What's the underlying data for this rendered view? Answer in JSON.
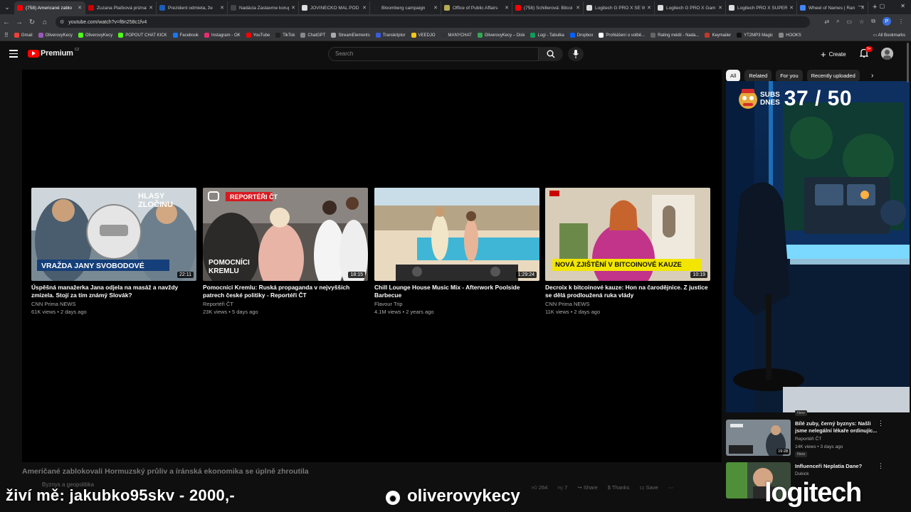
{
  "browser": {
    "tabs": [
      {
        "title": "(758) Americané zablo",
        "color": "#ff0000",
        "active": true
      },
      {
        "title": "Zuzana Plačková priznal",
        "color": "#cc0000"
      },
      {
        "title": "Prezident odmieta, že",
        "color": "#1a5fb4"
      },
      {
        "title": "Nadácia Zastavme korupc",
        "color": "#444444"
      },
      {
        "title": "JOVINEČKO MAL POD",
        "color": "#dddddd"
      },
      {
        "title": "Bloomberg campaign",
        "color": "#222222"
      },
      {
        "title": "Office of Public Affairs",
        "color": "#bbaa55"
      },
      {
        "title": "(758) Schillerová: Bitcoi",
        "color": "#ff0000"
      },
      {
        "title": "Logitech G PRO X SE W",
        "color": "#dddddd"
      },
      {
        "title": "Logitech G PRO X Gam",
        "color": "#dddddd"
      },
      {
        "title": "Logitech PRO X SUPER",
        "color": "#dddddd"
      },
      {
        "title": "Wheel of Names | Ran",
        "color": "#4285f4"
      }
    ],
    "url": "youtube.com/watch?v=f8n258c1fv4",
    "profile_letter": "P",
    "bookmarks": [
      {
        "label": "Gmail",
        "color": "#ea4335"
      },
      {
        "label": "OliverovyKecy",
        "color": "#9b59b6"
      },
      {
        "label": "OliverovyKecy",
        "color": "#53fc18"
      },
      {
        "label": "POPOUT CHAT KICK",
        "color": "#53fc18"
      },
      {
        "label": "Facebook",
        "color": "#1877f2"
      },
      {
        "label": "Instagram - OK",
        "color": "#e1306c"
      },
      {
        "label": "YouTube",
        "color": "#ff0000"
      },
      {
        "label": "TikTok",
        "color": "#222222"
      },
      {
        "label": "ChatGPT",
        "color": "#888888"
      },
      {
        "label": "StreamElements",
        "color": "#aaaaaa"
      },
      {
        "label": "Transkriptor",
        "color": "#3b5bdb"
      },
      {
        "label": "VEEDJO",
        "color": "#f5c518"
      },
      {
        "label": "MANYCHAT",
        "color": "#333333"
      },
      {
        "label": "OliverovyKecy – Disk",
        "color": "#34a853"
      },
      {
        "label": "Logi - Tabulka",
        "color": "#0f9d58"
      },
      {
        "label": "Dropbox",
        "color": "#0061ff"
      },
      {
        "label": "Prohlášení o volbě...",
        "color": "#ffffff"
      },
      {
        "label": "Rating médií - Nada...",
        "color": "#666666"
      },
      {
        "label": "Keymailer",
        "color": "#c0392b"
      },
      {
        "label": "YT2MP3 Magic",
        "color": "#111111"
      },
      {
        "label": "HOOKS",
        "color": "#888888"
      }
    ],
    "all_bookmarks": "All Bookmarks"
  },
  "youtube": {
    "logo": "Premium",
    "logo_country": "CZ",
    "search_placeholder": "Search",
    "create_label": "Create",
    "notif_badge": "9+"
  },
  "endscreen": [
    {
      "title": "Úspěšná manažerka Jana odjela na masáž a navždy zmizela. Stojí za tím známý Slovák?",
      "channel": "CNN Prima NEWS",
      "meta": "61K views • 2 days ago",
      "duration": "22:11",
      "banner": "VRAŽDA JANY SVOBODOVÉ",
      "corner": "HLASY ZLOČINU"
    },
    {
      "title": "Pomocníci Kremlu: Ruská propaganda v nejvyšších patrech české politiky - Reportéři ČT",
      "channel": "Reportéři ČT",
      "meta": "23K views • 5 days ago",
      "duration": "18:15",
      "banner": "POMOCNÍCI KREMLU",
      "corner": "REPORTÉŘI ČT"
    },
    {
      "title": "Chill Lounge House Music Mix - Afterwork Poolside Barbecue",
      "channel": "Flavour Trip",
      "meta": "4.1M views • 2 years ago",
      "duration": "1:29:24",
      "banner": "",
      "corner": ""
    },
    {
      "title": "Decroix k bitcoinové kauze: Hon na čarodějnice. Z justice se dělá prodloužená ruka vlády",
      "channel": "CNN Prima NEWS",
      "meta": "11K views • 2 days ago",
      "duration": "10:19",
      "banner": "NOVÁ ZJIŠTĚNÍ V BITCOINOVÉ KAUZE",
      "corner": ""
    }
  ],
  "video": {
    "title": "Američané zablokovali Hormuzský průliv a íránská ekonomika se úplně zhroutila",
    "channel": "Byznys a geopolitika",
    "likes": "264",
    "dislikes": "7",
    "share": "Share",
    "thanks": "Thanks",
    "save": "Save"
  },
  "chips": [
    "All",
    "Related",
    "For you",
    "Recently uploaded"
  ],
  "overlay": {
    "subs_label_1": "SUBS",
    "subs_label_2": "DNES",
    "subs_count": "37 / 50",
    "donation": "živí mě: jakubko95skv - 2000,-",
    "handle": "oliverovykecy",
    "brand": "logitech"
  },
  "recommendations": [
    {
      "badge_top": "New",
      "title": "Bílé zuby, černý byznys: Našli jsme nelegální lékaře ordinujíc...",
      "channel": "Reportéři ČT",
      "meta": "14K views • 3 days ago",
      "badge": "New",
      "duration": "19:28"
    },
    {
      "title": "Influenceři Neplatia Dane?",
      "channel": "Dukick"
    }
  ]
}
